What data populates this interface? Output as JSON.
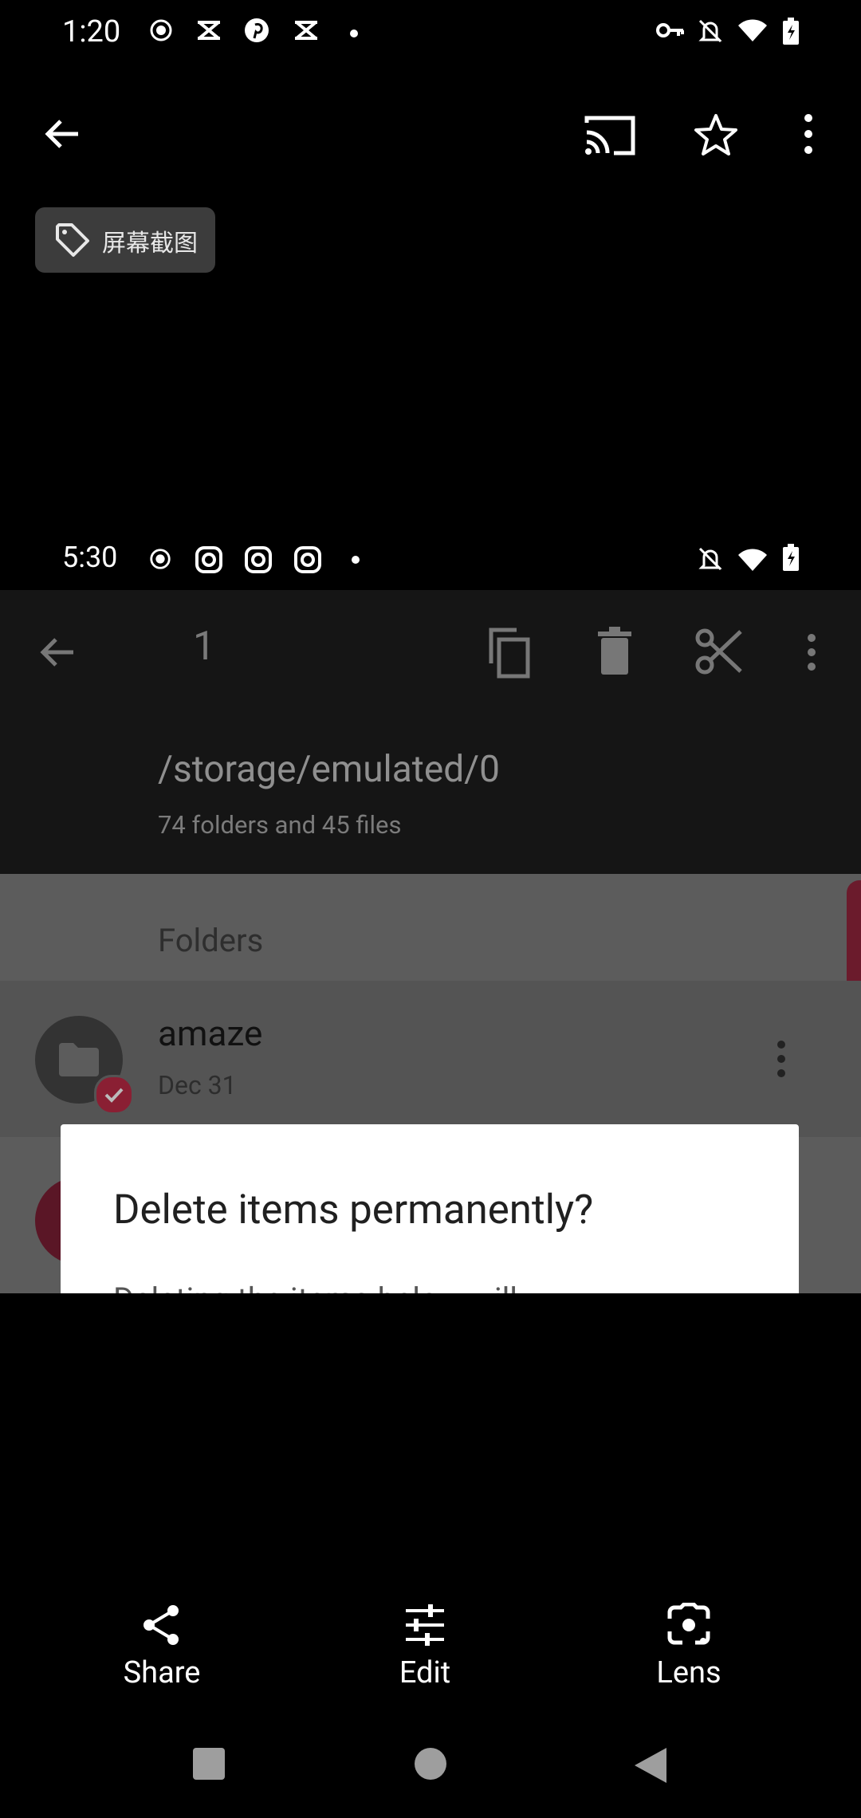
{
  "status_bar": {
    "time": "1:20",
    "left_icons": [
      "record-icon",
      "capcut-icon",
      "pinterest-icon",
      "capcut-icon",
      "dot-icon"
    ],
    "right_icons": [
      "key-icon",
      "bell-off-icon",
      "wifi-icon",
      "battery-charging-icon"
    ]
  },
  "toolbar": {
    "icons": [
      "back-arrow-icon",
      "cast-icon",
      "star-icon",
      "more-vert-icon"
    ]
  },
  "tag_chip": {
    "label": "屏幕截图",
    "icon": "tag-icon"
  },
  "screenshot": {
    "status_bar": {
      "time": "5:30",
      "left_icons": [
        "record-icon",
        "instagram-icon",
        "instagram-icon",
        "instagram-icon",
        "dot-icon"
      ],
      "right_icons": [
        "bell-off-icon",
        "wifi-icon",
        "battery-charging-icon"
      ]
    },
    "selection_toolbar": {
      "count": "1",
      "icons": [
        "back-arrow-icon",
        "copy-icon",
        "delete-icon",
        "cut-icon",
        "more-vert-icon"
      ]
    },
    "path": "/storage/emulated/0",
    "summary": "74 folders and 45 files",
    "section_header": "Folders",
    "folder_row": {
      "name": "amaze",
      "date": "Dec 31"
    },
    "dialog": {
      "title": "Delete items permanently?",
      "body_partial": "Deleting the items below will..."
    },
    "colors": {
      "accent": "#b0243f",
      "dim_overlay": "#5c5c5c"
    }
  },
  "bottom_actions": [
    {
      "label": "Share",
      "icon": "share-icon"
    },
    {
      "label": "Edit",
      "icon": "tune-icon"
    },
    {
      "label": "Lens",
      "icon": "lens-icon"
    }
  ],
  "nav_bar": {
    "icons": [
      "recents-square-icon",
      "home-circle-icon",
      "back-triangle-icon"
    ]
  }
}
